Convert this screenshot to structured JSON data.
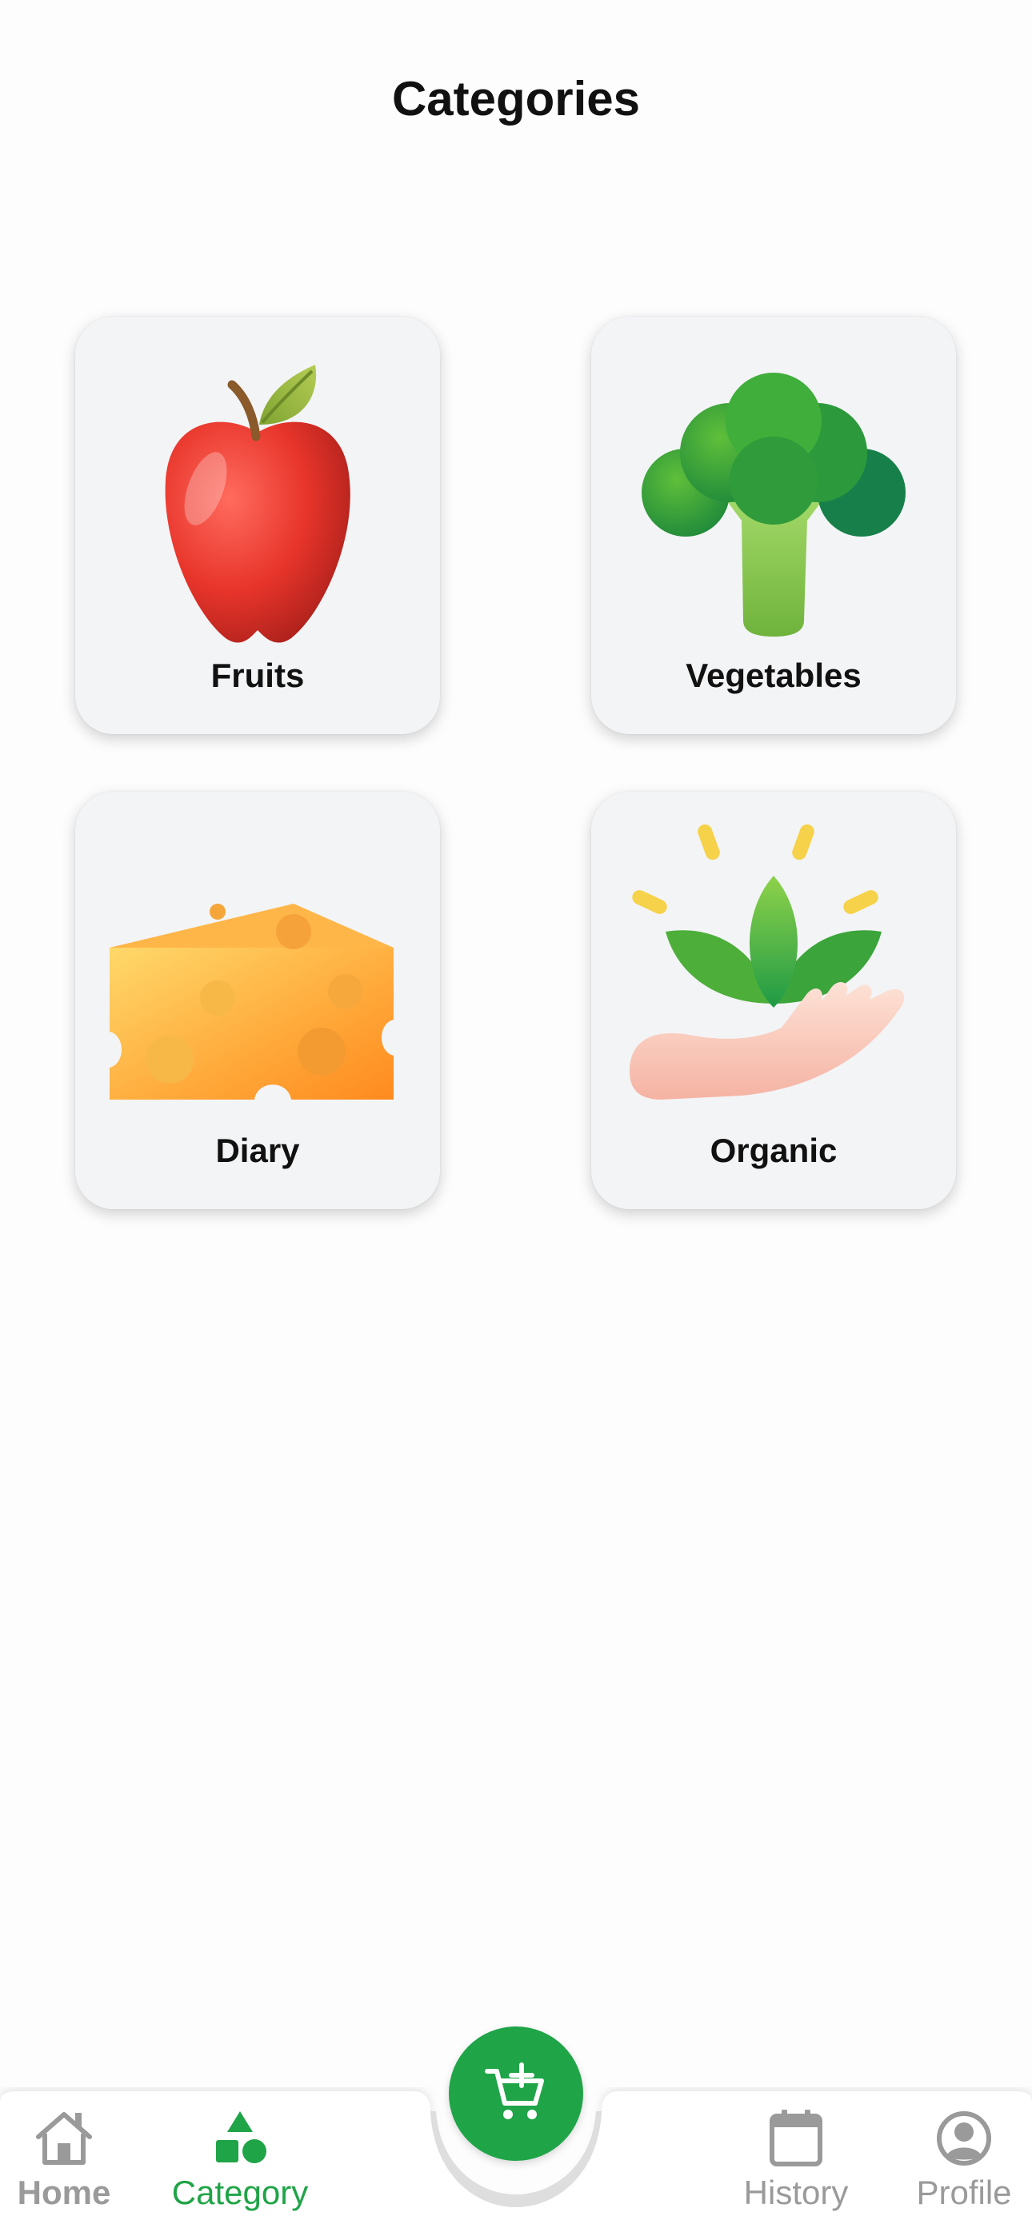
{
  "header": {
    "title": "Categories"
  },
  "categories": [
    {
      "label": "Fruits",
      "icon": "apple-icon"
    },
    {
      "label": "Vegetables",
      "icon": "broccoli-icon"
    },
    {
      "label": "Diary",
      "icon": "cheese-icon"
    },
    {
      "label": "Organic",
      "icon": "organic-hand-leaf-icon"
    }
  ],
  "bottom_nav": {
    "items": [
      {
        "label": "Home",
        "icon": "home-icon",
        "active": false
      },
      {
        "label": "Category",
        "icon": "category-shapes-icon",
        "active": true
      },
      {
        "label": "History",
        "icon": "calendar-icon",
        "active": false
      },
      {
        "label": "Profile",
        "icon": "user-icon",
        "active": false
      }
    ],
    "fab_icon": "add-to-cart-icon"
  },
  "colors": {
    "accent": "#1fa447",
    "inactive": "#9a9a9a",
    "card_bg": "#f3f4f6"
  }
}
